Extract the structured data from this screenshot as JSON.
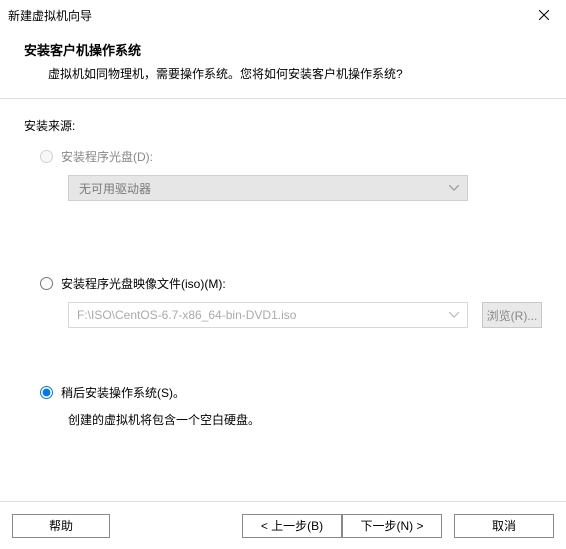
{
  "window": {
    "title": "新建虚拟机向导"
  },
  "header": {
    "heading": "安装客户机操作系统",
    "sub": "虚拟机如同物理机，需要操作系统。您将如何安装客户机操作系统?"
  },
  "body": {
    "source_label": "安装来源:",
    "option1": {
      "label": "安装程序光盘(D):",
      "dropdown": "无可用驱动器"
    },
    "option2": {
      "label": "安装程序光盘映像文件(iso)(M):",
      "path": "F:\\ISO\\CentOS-6.7-x86_64-bin-DVD1.iso",
      "browse": "浏览(R)..."
    },
    "option3": {
      "label": "稍后安装操作系统(S)。",
      "desc": "创建的虚拟机将包含一个空白硬盘。"
    }
  },
  "footer": {
    "help": "帮助",
    "back": "< 上一步(B)",
    "next": "下一步(N) >",
    "cancel": "取消"
  }
}
